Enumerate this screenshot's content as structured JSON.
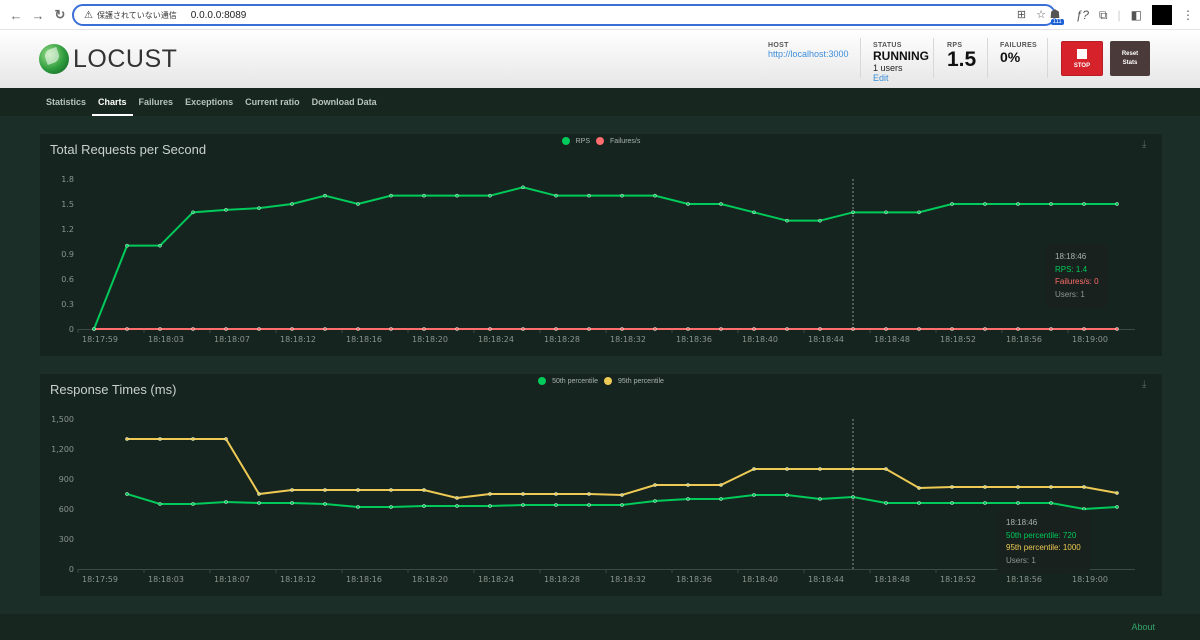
{
  "browser": {
    "insecure_label": "保護されていない通信",
    "url": "0.0.0.0:8089",
    "extension_badge": "111"
  },
  "header": {
    "logo_text": "LOCUST",
    "host_label": "HOST",
    "host_value": "http://localhost:3000",
    "status_label": "STATUS",
    "status_value": "RUNNING",
    "users_value": "1 users",
    "edit_label": "Edit",
    "rps_label": "RPS",
    "rps_value": "1.5",
    "failures_label": "FAILURES",
    "failures_value": "0%",
    "stop_label": "STOP",
    "reset_label_line1": "Reset",
    "reset_label_line2": "Stats"
  },
  "tabs": [
    {
      "label": "Statistics",
      "active": false
    },
    {
      "label": "Charts",
      "active": true
    },
    {
      "label": "Failures",
      "active": false
    },
    {
      "label": "Exceptions",
      "active": false
    },
    {
      "label": "Current ratio",
      "active": false
    },
    {
      "label": "Download Data",
      "active": false
    }
  ],
  "footer": {
    "about_label": "About"
  },
  "colors": {
    "green": "#00ca5a",
    "red": "#ff6d6d",
    "yellow": "#eeca54",
    "axis_text": "#8b948f",
    "axis_line": "#3a4a43"
  },
  "chart_data": [
    {
      "type": "line",
      "title": "Total Requests per Second",
      "xlabel": "",
      "ylabel": "",
      "ylim": [
        0,
        1.8
      ],
      "yticks": [
        "0",
        "0.3",
        "0.6",
        "0.9",
        "1.2",
        "1.5",
        "1.8"
      ],
      "ytick_values": [
        0,
        0.3,
        0.6,
        0.9,
        1.2,
        1.5,
        1.8
      ],
      "xtick_labels": [
        "18:17:59",
        "18:18:03",
        "18:18:07",
        "18:18:12",
        "18:18:16",
        "18:18:20",
        "18:18:24",
        "18:18:28",
        "18:18:32",
        "18:18:36",
        "18:18:40",
        "18:18:44",
        "18:18:48",
        "18:18:52",
        "18:18:56",
        "18:19:00"
      ],
      "grid": false,
      "legend_position": "top-center",
      "series": [
        {
          "name": "RPS",
          "color": "#00ca5a",
          "values": [
            0,
            1.0,
            1.0,
            1.4,
            1.43,
            1.45,
            1.5,
            1.6,
            1.5,
            1.6,
            1.6,
            1.6,
            1.6,
            1.7,
            1.6,
            1.6,
            1.6,
            1.6,
            1.5,
            1.5,
            1.4,
            1.3,
            1.3,
            1.4,
            1.4,
            1.4,
            1.5,
            1.5,
            1.5,
            1.5,
            1.5,
            1.5
          ]
        },
        {
          "name": "Failures/s",
          "color": "#ff6d6d",
          "values": [
            0,
            0,
            0,
            0,
            0,
            0,
            0,
            0,
            0,
            0,
            0,
            0,
            0,
            0,
            0,
            0,
            0,
            0,
            0,
            0,
            0,
            0,
            0,
            0,
            0,
            0,
            0,
            0,
            0,
            0,
            0,
            0
          ]
        }
      ],
      "hover_index": 23,
      "tooltip": {
        "time": "18:18:46",
        "lines": [
          {
            "text": "RPS: 1.4",
            "color": "#00ca5a"
          },
          {
            "text": "Failures/s: 0",
            "color": "#ff6d6d"
          }
        ],
        "users": "Users: 1"
      }
    },
    {
      "type": "line",
      "title": "Response Times (ms)",
      "xlabel": "",
      "ylabel": "",
      "ylim": [
        0,
        1500
      ],
      "yticks": [
        "0",
        "300",
        "600",
        "900",
        "1,200",
        "1,500"
      ],
      "ytick_values": [
        0,
        300,
        600,
        900,
        1200,
        1500
      ],
      "xtick_labels": [
        "18:17:59",
        "18:18:03",
        "18:18:07",
        "18:18:12",
        "18:18:16",
        "18:18:20",
        "18:18:24",
        "18:18:28",
        "18:18:32",
        "18:18:36",
        "18:18:40",
        "18:18:44",
        "18:18:48",
        "18:18:52",
        "18:18:56",
        "18:19:00"
      ],
      "grid": false,
      "legend_position": "top-center",
      "series": [
        {
          "name": "50th percentile",
          "color": "#00ca5a",
          "values": [
            null,
            750,
            650,
            650,
            670,
            660,
            660,
            650,
            620,
            620,
            630,
            630,
            630,
            640,
            640,
            640,
            640,
            680,
            700,
            700,
            740,
            740,
            700,
            720,
            660,
            660,
            660,
            660,
            660,
            660,
            600,
            620
          ]
        },
        {
          "name": "95th percentile",
          "color": "#eeca54",
          "values": [
            null,
            1300,
            1300,
            1300,
            1300,
            750,
            790,
            790,
            790,
            790,
            790,
            710,
            750,
            750,
            750,
            750,
            740,
            840,
            840,
            840,
            1000,
            1000,
            1000,
            1000,
            1000,
            810,
            820,
            820,
            820,
            820,
            820,
            760
          ]
        }
      ],
      "hover_index": 23,
      "tooltip": {
        "time": "18:18:46",
        "lines": [
          {
            "text": "50th percentile: 720",
            "color": "#00ca5a"
          },
          {
            "text": "95th percentile: 1000",
            "color": "#eeca54"
          }
        ],
        "users": "Users: 1"
      }
    }
  ]
}
